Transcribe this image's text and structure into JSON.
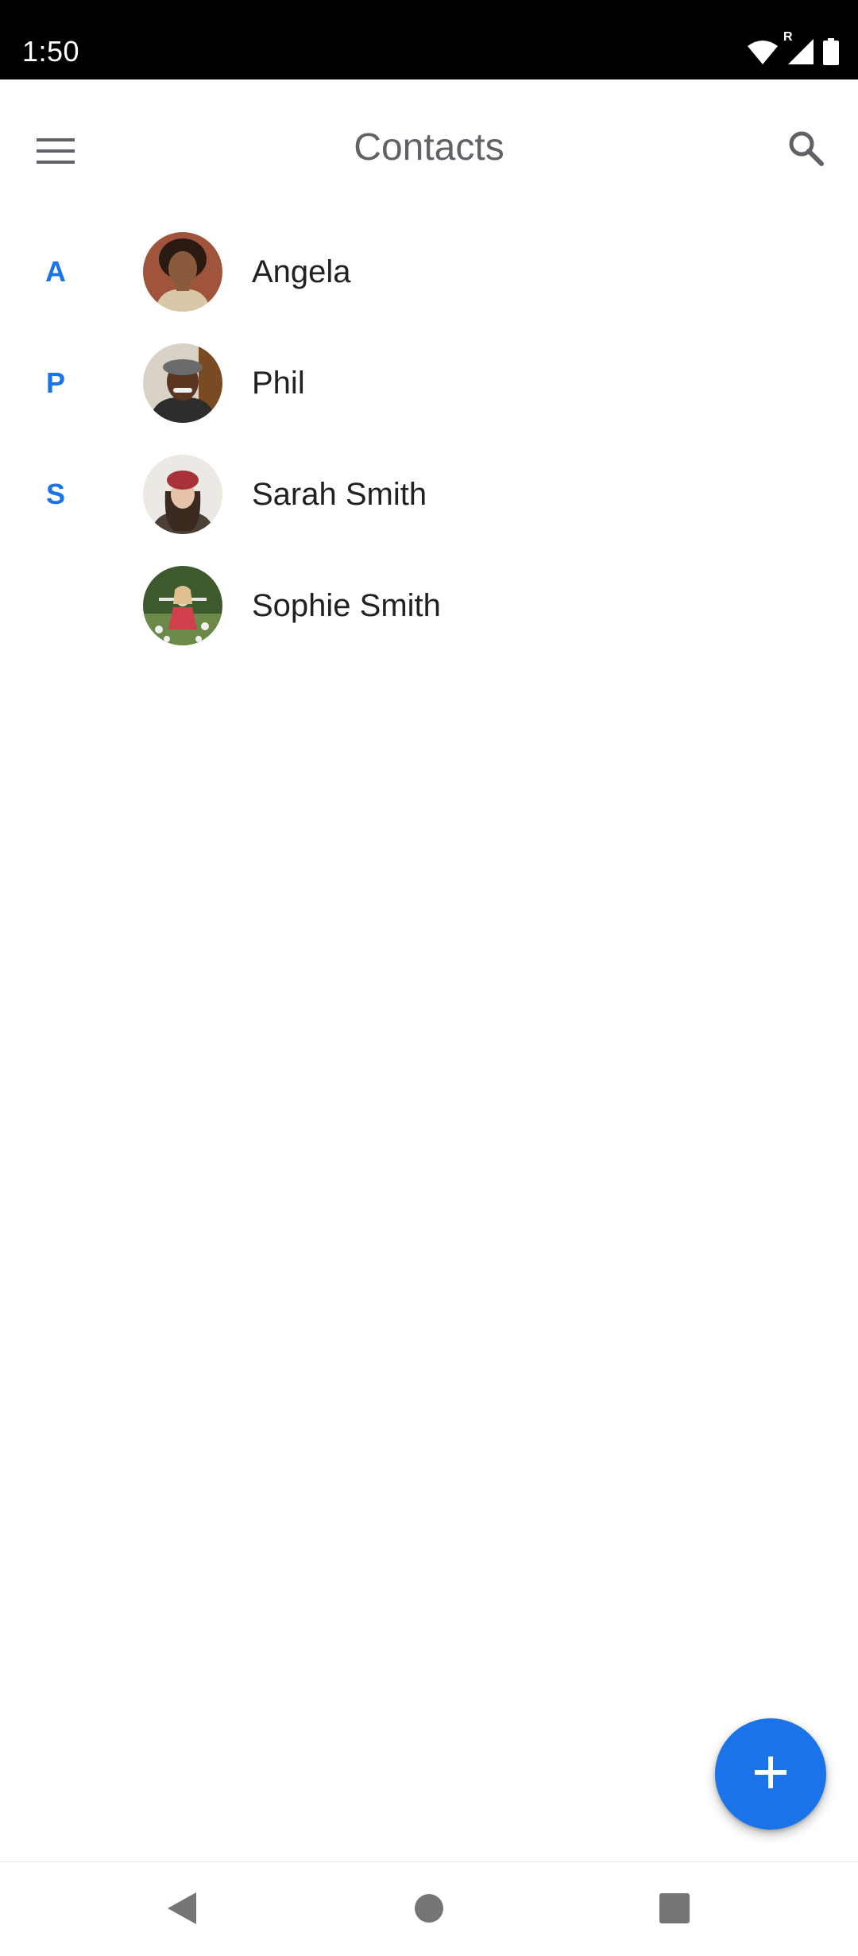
{
  "status_bar": {
    "time": "1:50",
    "icons": [
      "wifi-icon",
      "roaming-r-icon",
      "cell-signal-icon",
      "battery-icon"
    ],
    "roaming_label": "R"
  },
  "app_bar": {
    "title": "Contacts",
    "menu_icon": "hamburger-menu-icon",
    "search_icon": "search-icon"
  },
  "contacts": [
    {
      "section": "A",
      "name": "Angela"
    },
    {
      "section": "P",
      "name": "Phil"
    },
    {
      "section": "S",
      "name": "Sarah Smith"
    },
    {
      "section": "",
      "name": "Sophie Smith"
    }
  ],
  "fab": {
    "icon": "plus-icon"
  },
  "nav_bar": {
    "icons": [
      "back-icon",
      "home-icon",
      "recents-icon"
    ]
  },
  "colors": {
    "accent": "#1a73e8",
    "title": "#5f6368",
    "text": "#202124",
    "status_bar": "#000000"
  }
}
